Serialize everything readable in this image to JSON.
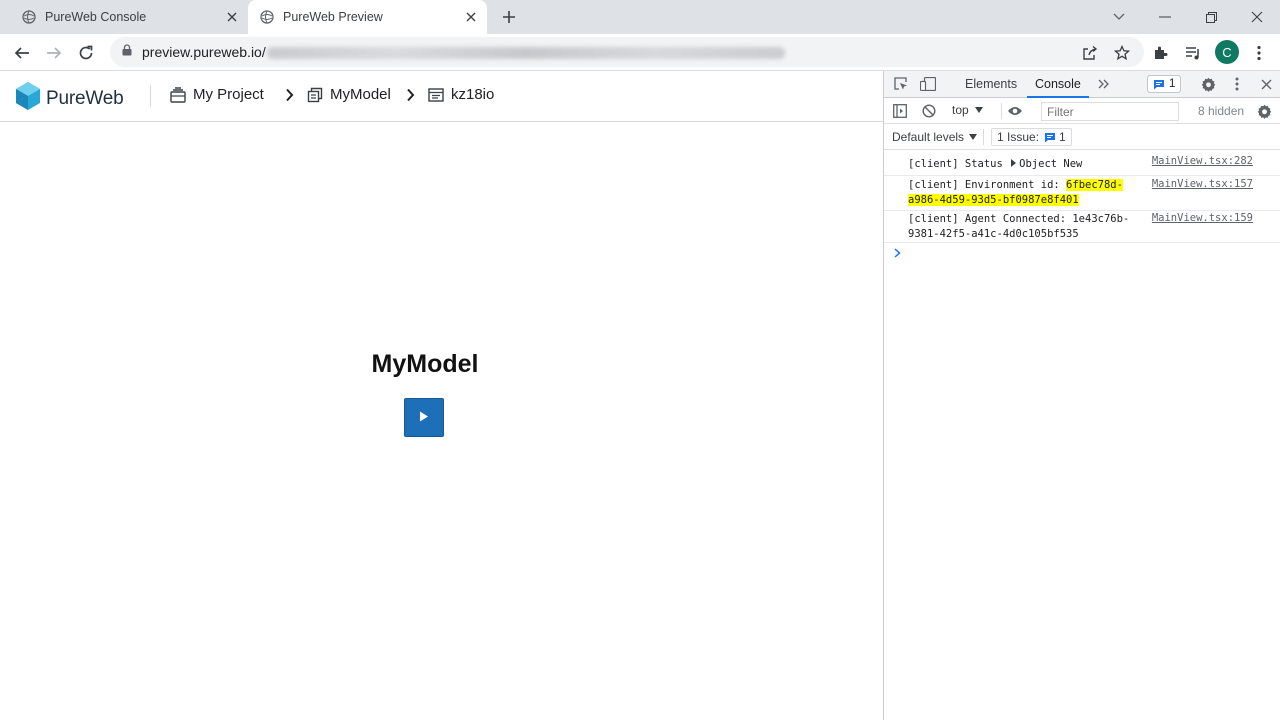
{
  "browser": {
    "tabs": [
      {
        "title": "PureWeb Console",
        "active": false
      },
      {
        "title": "PureWeb Preview",
        "active": true
      }
    ],
    "url_visible": "preview.pureweb.io/",
    "profile_initial": "C"
  },
  "app": {
    "brand": "PureWeb",
    "breadcrumb": [
      {
        "label": "My Project",
        "icon": "project-icon"
      },
      {
        "label": "MyModel",
        "icon": "model-icon"
      },
      {
        "label": "kz18io",
        "icon": "environment-icon"
      }
    ],
    "model_title": "MyModel",
    "accent_color": "#1d70b8"
  },
  "devtools": {
    "tabs": [
      "Elements",
      "Console"
    ],
    "active_tab": "Console",
    "issues_badge": "1",
    "context": "top",
    "filter_placeholder": "Filter",
    "hidden_count": "8 hidden",
    "levels": "Default levels",
    "issue_label": "1 Issue:",
    "issue_count": "1",
    "logs": [
      {
        "prefix": "[client] Status ",
        "object": "Object",
        "suffix": " New",
        "source": "MainView.tsx:282"
      },
      {
        "line1_prefix": "[client] Environment id: ",
        "line1_hl": "6fbec78d-",
        "line2_hl": "a986-4d59-93d5-bf0987e8f401",
        "source": "MainView.tsx:157"
      },
      {
        "line1": "[client] Agent Connected: 1e43c76b-",
        "line2": "9381-42f5-a41c-4d0c105bf535",
        "source": "MainView.tsx:159"
      }
    ]
  }
}
